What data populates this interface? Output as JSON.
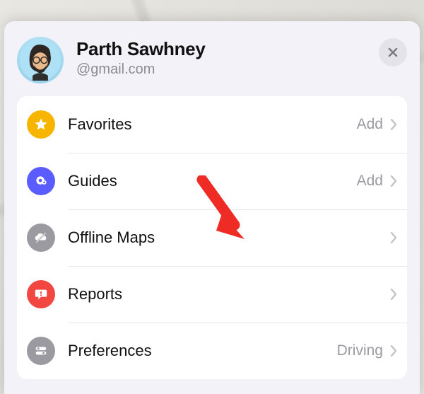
{
  "user": {
    "name": "Parth Sawhney",
    "email_suffix": "@gmail.com"
  },
  "menu": {
    "favorites": {
      "label": "Favorites",
      "action": "Add"
    },
    "guides": {
      "label": "Guides",
      "action": "Add"
    },
    "offline_maps": {
      "label": "Offline Maps"
    },
    "reports": {
      "label": "Reports"
    },
    "preferences": {
      "label": "Preferences",
      "value": "Driving"
    }
  },
  "icons": {
    "close": "close-icon",
    "favorites": "star-icon",
    "guides": "pin-group-icon",
    "offline": "cloud-slash-icon",
    "reports": "speech-alert-icon",
    "preferences": "toggles-icon",
    "chevron": "chevron-right-icon"
  },
  "colors": {
    "favorites": "#f7b500",
    "guides": "#5a5cff",
    "offline": "#9b9aa1",
    "reports": "#f24741",
    "preferences": "#9b9aa1",
    "annotation": "#ee2b24"
  }
}
